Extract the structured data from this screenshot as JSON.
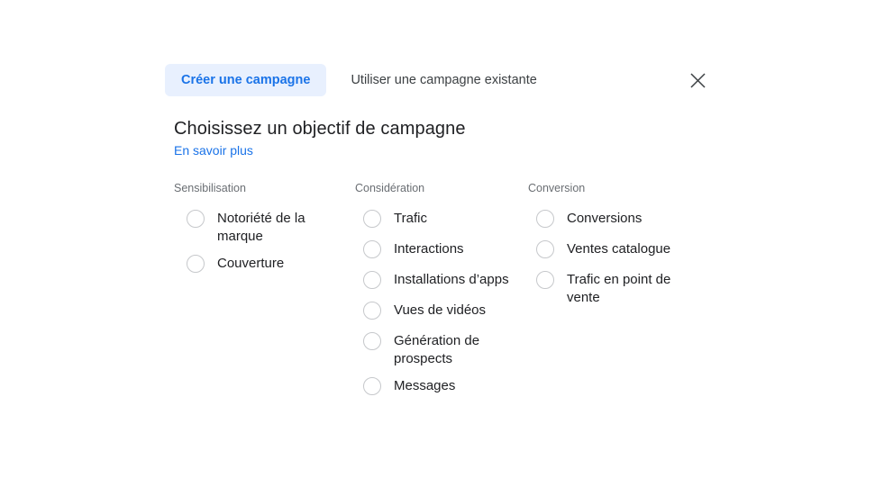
{
  "dialog": {
    "tabs": [
      {
        "label": "Créer une campagne",
        "active": true
      },
      {
        "label": "Utiliser une campagne existante",
        "active": false
      }
    ],
    "close_icon": "close-icon",
    "title": "Choisissez un objectif de campagne",
    "learn_more": "En savoir plus",
    "columns": [
      {
        "header": "Sensibilisation",
        "options": [
          {
            "label": "Notoriété de la marque",
            "selected": false
          },
          {
            "label": "Couverture",
            "selected": false
          }
        ]
      },
      {
        "header": "Considération",
        "options": [
          {
            "label": "Trafic",
            "selected": false
          },
          {
            "label": "Interactions",
            "selected": false
          },
          {
            "label": "Installations d’apps",
            "selected": false
          },
          {
            "label": "Vues de vidéos",
            "selected": false
          },
          {
            "label": "Génération de prospects",
            "selected": false
          },
          {
            "label": "Messages",
            "selected": false
          }
        ]
      },
      {
        "header": "Conversion",
        "options": [
          {
            "label": "Conversions",
            "selected": false
          },
          {
            "label": "Ventes catalogue",
            "selected": false
          },
          {
            "label": "Trafic en point de vente",
            "selected": false
          }
        ]
      }
    ]
  },
  "colors": {
    "accent": "#1a73e8",
    "accent_bg": "#e8f0fe",
    "text_primary": "#202124",
    "text_secondary": "#3c4043",
    "text_muted": "#6a6e73",
    "radio_border": "#c6c8cb",
    "background": "#ffffff"
  }
}
